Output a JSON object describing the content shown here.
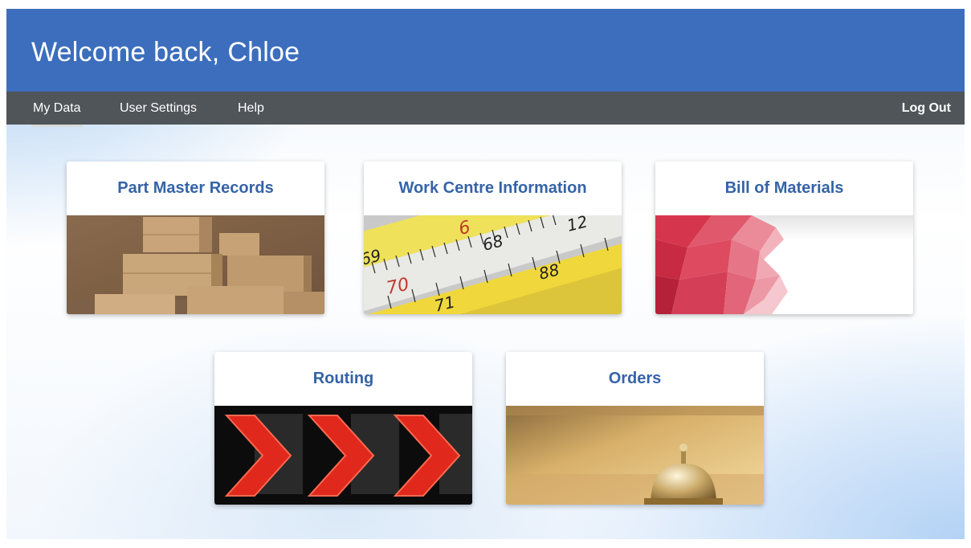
{
  "header": {
    "greeting": "Welcome back,",
    "user_name": "Chloe"
  },
  "nav": {
    "items": [
      {
        "label": "My Data",
        "active": true
      },
      {
        "label": "User Settings",
        "active": false
      },
      {
        "label": "Help",
        "active": false
      }
    ],
    "logout_label": "Log Out"
  },
  "cards": [
    {
      "title": "Part Master Records",
      "image": "cardboard-boxes-image"
    },
    {
      "title": "Work Centre Information",
      "image": "measuring-tape-image"
    },
    {
      "title": "Bill of Materials",
      "image": "red-polygon-image"
    },
    {
      "title": "Routing",
      "image": "red-led-arrows-image"
    },
    {
      "title": "Orders",
      "image": "service-bell-image"
    }
  ],
  "colors": {
    "header_bg": "#3c6ebd",
    "nav_bg": "#4f5559",
    "card_title": "#3563a8"
  }
}
